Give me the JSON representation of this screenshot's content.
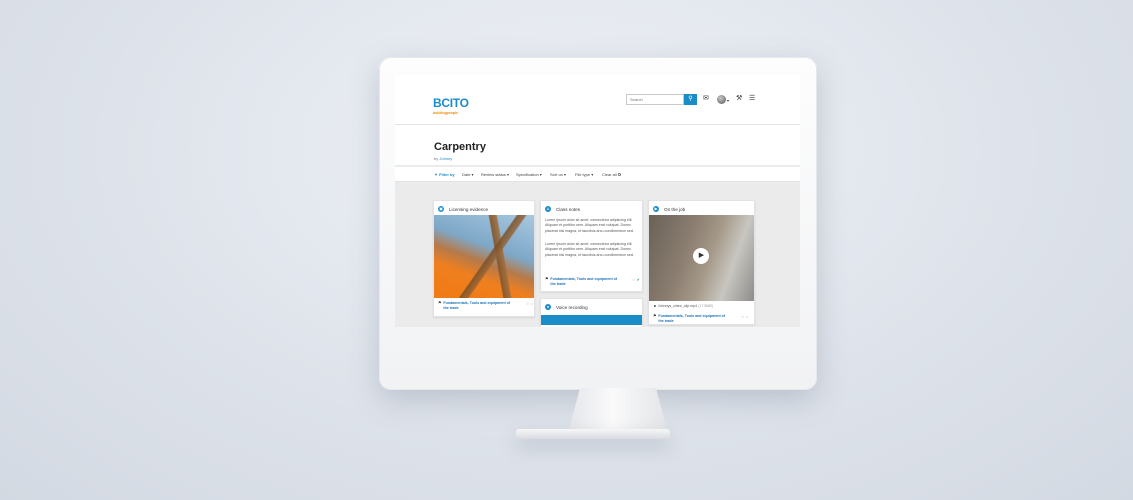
{
  "header": {
    "logo_main": "BCITO",
    "logo_sub": "buildingpeople",
    "search_placeholder": "Search",
    "icons": [
      "search-icon",
      "mail-icon",
      "avatar",
      "wrench-icon",
      "menu-icon"
    ]
  },
  "page": {
    "title": "Carpentry",
    "by_label": "by",
    "author": "Johnny"
  },
  "filters": {
    "filter_by": "Filter by",
    "items": [
      "Date ▾",
      "Review status ▾",
      "Specification ▾",
      "Sort on ▾",
      "File type ▾",
      "Clear all ✪"
    ]
  },
  "cards": [
    {
      "title": "Licensing evidence",
      "tag": "Fundamentals, Tools and equipment of the trade"
    },
    {
      "title": "Class notes",
      "paragraph1": "Lorem ipsum dolor sit amet, consectetur adipiscing elit. Aliquam et porttitor sem. Aliquam erat volutpat. Donec placerat nisl magna, et faucibus arcu condimentum sed.",
      "paragraph2": "Lorem ipsum dolor sit amet, consectetur adipiscing elit. Aliquam et porttitor sem. Aliquam erat volutpat. Donec placerat nisl magna, et faucibus arcu condimentum sed.",
      "tag": "Fundamentals, Tools and equipment of the trade"
    },
    {
      "title": "On the job",
      "file_name": "Johnnys_video_clip.mp4",
      "file_size": "(17.5MB)",
      "tag": "Fundamentals, Tools and equipment of the trade"
    },
    {
      "title": "Voice recording"
    }
  ],
  "colors": {
    "brand_blue": "#1a8dc9",
    "brand_orange": "#f08a00",
    "approved_green": "#1e9b3c"
  }
}
